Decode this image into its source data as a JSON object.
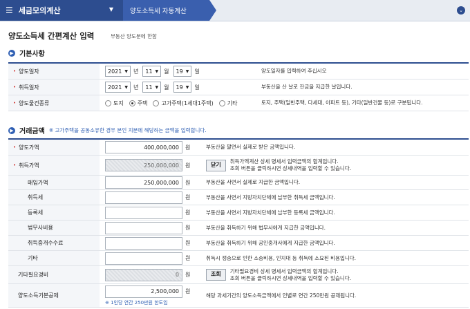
{
  "nav": {
    "menu_label": "세금모의계산",
    "sub_label": "양도소득세 자동계산"
  },
  "page": {
    "title": "양도소득세 간편계산 입력",
    "subtitle": "부동산 양도분에 한함"
  },
  "basic": {
    "heading": "기본사항",
    "rows": {
      "transfer_date": {
        "label": "양도일자",
        "year": "2021",
        "month": "11",
        "day": "19",
        "unit_year": "년",
        "unit_month": "월",
        "unit_day": "일",
        "desc": "양도일자를 입력하여 주십시오"
      },
      "acquire_date": {
        "label": "취득일자",
        "year": "2021",
        "month": "11",
        "day": "19",
        "unit_year": "년",
        "unit_month": "월",
        "unit_day": "일",
        "desc": "부동산을 산 날로 잔금을 지급한 날입니다."
      },
      "kind": {
        "label": "양도물건종류",
        "options": [
          "토지",
          "주택",
          "고가주택(1세대1주택)",
          "기타"
        ],
        "selected": "주택",
        "desc": "토지, 주택(일반주택, 다세대, 아파트 등), 기타(일반건물 등)로 구분됩니다."
      }
    }
  },
  "amount": {
    "heading": "거래금액",
    "note": "※ 고가주택을 공동소유한 경우 본인 지분에 해당하는 금액을 입력합니다.",
    "won": "원",
    "rows": {
      "transfer_price": {
        "label": "양도가액",
        "value": "400,000,000",
        "desc": "부동산을 팔면서 실제로 받은 금액입니다."
      },
      "acquire_price": {
        "label": "취득가액",
        "value": "250,000,000",
        "button": "닫기",
        "desc1": "취득가액계산 상세 명세서 입력금액의 합계입니다.",
        "desc2": "조회 버튼을 클릭하시면 상세내역을 입력할 수 있습니다."
      },
      "purchase_price": {
        "label": "매입가액",
        "value": "250,000,000",
        "desc": "부동산을 사면서 실제로 지급한 금액입니다."
      },
      "acq_tax": {
        "label": "취득세",
        "value": "",
        "desc": "부동산을 사면서 지방자치단체에 납부한 취득세 금액입니다."
      },
      "reg_tax": {
        "label": "등록세",
        "value": "",
        "desc": "부동산을 사면서 지방자치단체에 납부한 등록세 금액입니다."
      },
      "legal_fee": {
        "label": "법무사비용",
        "value": "",
        "desc": "부동산을 취득하기 위해 법무사에게 지급한 금액입니다."
      },
      "broker_fee": {
        "label": "취득중개수수료",
        "value": "",
        "desc": "부동산을 취득하기 위해 공인중개사에게 지급한 금액입니다."
      },
      "other": {
        "label": "기타",
        "value": "",
        "desc": "취득시 쟁송으로 인한 소송비용, 인지대 등 취득에 소요된 비용입니다."
      },
      "other_expense": {
        "label": "기타필요경비",
        "value": "0",
        "button": "조회",
        "desc1": "기타필요경비 상세 명세서 입력금액의 합계입니다.",
        "desc2": "조회 버튼을 클릭하시면 상세내역을 입력할 수 있습니다."
      },
      "basic_deduction": {
        "label": "양도소득기본공제",
        "value": "2,500,000",
        "note": "※ 1인당 연간 250만원 한도임",
        "desc": "해당 과세기간의 양도소득금액에서 인별로 연간 250만원 공제됩니다."
      }
    }
  }
}
